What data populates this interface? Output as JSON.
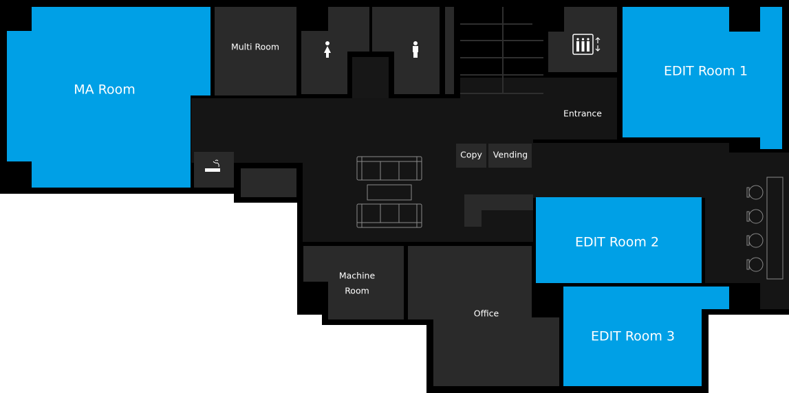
{
  "colors": {
    "bookable_room": "#00a0e6",
    "room": "#2a2a2a",
    "corridor": "#151515",
    "wall": "#000000"
  },
  "rooms": {
    "ma_room": "MA Room",
    "multi_room": "Multi Room",
    "entrance": "Entrance",
    "copy": "Copy",
    "vending": "Vending",
    "edit_room_1": "EDIT Room 1",
    "edit_room_2": "EDIT Room 2",
    "edit_room_3": "EDIT Room 3",
    "machine_room_line1": "Machine",
    "machine_room_line2": "Room",
    "office": "Office"
  },
  "icons": [
    "womens-restroom-icon",
    "mens-restroom-icon",
    "elevator-icon",
    "smoking-area-icon",
    "sofa-icon",
    "table-icon",
    "stool-icon",
    "stairs-icon"
  ]
}
